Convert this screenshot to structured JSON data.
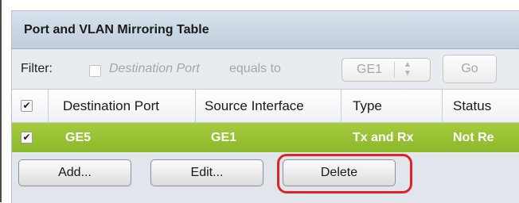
{
  "table": {
    "title": "Port and VLAN Mirroring Table",
    "filter": {
      "label": "Filter:",
      "field": "Destination Port",
      "operator": "equals to",
      "selected": "GE1",
      "go_label": "Go"
    },
    "columns": [
      "Destination Port",
      "Source Interface",
      "Type",
      "Status"
    ],
    "rows": [
      {
        "checked": true,
        "destination_port": "GE5",
        "source_interface": "GE1",
        "type": "Tx and Rx",
        "status": "Not Re"
      }
    ],
    "buttons": {
      "add": "Add...",
      "edit": "Edit...",
      "delete": "Delete"
    }
  },
  "colors": {
    "selected_row": "#9bc236",
    "highlight": "#e02323"
  }
}
